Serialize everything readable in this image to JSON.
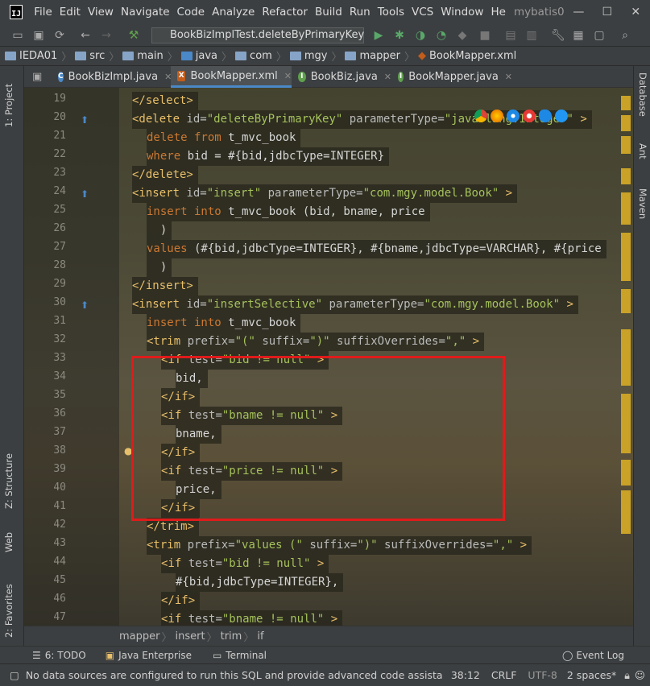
{
  "menubar": {
    "items": [
      "File",
      "Edit",
      "View",
      "Navigate",
      "Code",
      "Analyze",
      "Refactor",
      "Build",
      "Run",
      "Tools",
      "VCS",
      "Window",
      "He"
    ],
    "project_title": "mybatis0",
    "minimize": "—",
    "maximize": "☐",
    "close": "✕"
  },
  "toolbar": {
    "run_config": "BookBizImplTest.deleteByPrimaryKey"
  },
  "breadcrumb": {
    "items": [
      "IEDA01",
      "src",
      "main",
      "java",
      "com",
      "mgy",
      "mapper",
      "BookMapper.xml"
    ]
  },
  "tabs": [
    {
      "label": "BookBizImpl.java",
      "icon": "C",
      "color": "#4a88c7"
    },
    {
      "label": "BookMapper.xml",
      "icon": "X",
      "color": "#c25d1b"
    },
    {
      "label": "BookBiz.java",
      "icon": "I",
      "color": "#5fa04e"
    },
    {
      "label": "BookMapper.java",
      "icon": "I",
      "color": "#5fa04e"
    }
  ],
  "left_tools": [
    "1: Project",
    "Z: Structure",
    "Web",
    "2: Favorites"
  ],
  "right_tools": [
    "Database",
    "Ant",
    "Maven"
  ],
  "line_numbers": [
    "19",
    "20",
    "21",
    "22",
    "23",
    "24",
    "25",
    "26",
    "27",
    "28",
    "29",
    "30",
    "31",
    "32",
    "33",
    "34",
    "35",
    "36",
    "37",
    "38",
    "39",
    "40",
    "41",
    "42",
    "43",
    "44",
    "45",
    "46",
    "47"
  ],
  "code": {
    "l19": [
      "</select>"
    ],
    "l20": [
      "<delete",
      " id=",
      "\"deleteByPrimaryKey\"",
      " parameterType=",
      "\"java.lang.Integer\"",
      " >"
    ],
    "l21": [
      "delete from",
      " t_mvc_book"
    ],
    "l22": [
      "where",
      " bid = #{bid,jdbcType=INTEGER}"
    ],
    "l23": [
      "</delete>"
    ],
    "l24": [
      "<insert",
      " id=",
      "\"insert\"",
      " parameterType=",
      "\"com.mgy.model.Book\"",
      " >"
    ],
    "l25": [
      "insert into",
      " t_mvc_book (bid, bname, price"
    ],
    "l26": [
      "  )"
    ],
    "l27": [
      "values",
      " (#{bid,jdbcType=INTEGER}, #{bname,jdbcType=VARCHAR}, #{price"
    ],
    "l28": [
      "  )"
    ],
    "l29": [
      "</insert>"
    ],
    "l30": [
      "<insert",
      " id=",
      "\"insertSelective\"",
      " parameterType=",
      "\"com.mgy.model.Book\"",
      " >"
    ],
    "l31": [
      "insert into",
      " t_mvc_book"
    ],
    "l32": [
      "<trim",
      " prefix=",
      "\"(\"",
      " suffix=",
      "\")\"",
      " suffixOverrides=",
      "\",\"",
      " >"
    ],
    "l33": [
      "<if",
      " test=",
      "\"bid != null\"",
      " >"
    ],
    "l34": [
      "bid,"
    ],
    "l35": [
      "</if>"
    ],
    "l36": [
      "<if",
      " test=",
      "\"bname != null\"",
      " >"
    ],
    "l37": [
      "bname,"
    ],
    "l38": [
      "</if>"
    ],
    "l39": [
      "<if",
      " test=",
      "\"price != null\"",
      " >"
    ],
    "l40": [
      "price,"
    ],
    "l41": [
      "</if>"
    ],
    "l42": [
      "</trim>"
    ],
    "l43": [
      "<trim",
      " prefix=",
      "\"values (\"",
      " suffix=",
      "\")\"",
      " suffixOverrides=",
      "\",\"",
      " >"
    ],
    "l44": [
      "<if",
      " test=",
      "\"bid != null\"",
      " >"
    ],
    "l45": [
      "#{bid,jdbcType=INTEGER},"
    ],
    "l46": [
      "</if>"
    ],
    "l47": [
      "<if",
      " test=",
      "\"bname != null\"",
      " >"
    ]
  },
  "editor_breadcrumb": [
    "mapper",
    "insert",
    "trim",
    "if"
  ],
  "tool_windows": {
    "todo": "6: TODO",
    "java_enterprise": "Java Enterprise",
    "terminal": "Terminal",
    "event_log": "Event Log"
  },
  "status": {
    "message": "No data sources are configured to run this SQL and provide advanced code assistance....",
    "position": "38:12",
    "line_sep": "CRLF",
    "encoding": "UTF-8",
    "indent": "2 spaces*"
  }
}
